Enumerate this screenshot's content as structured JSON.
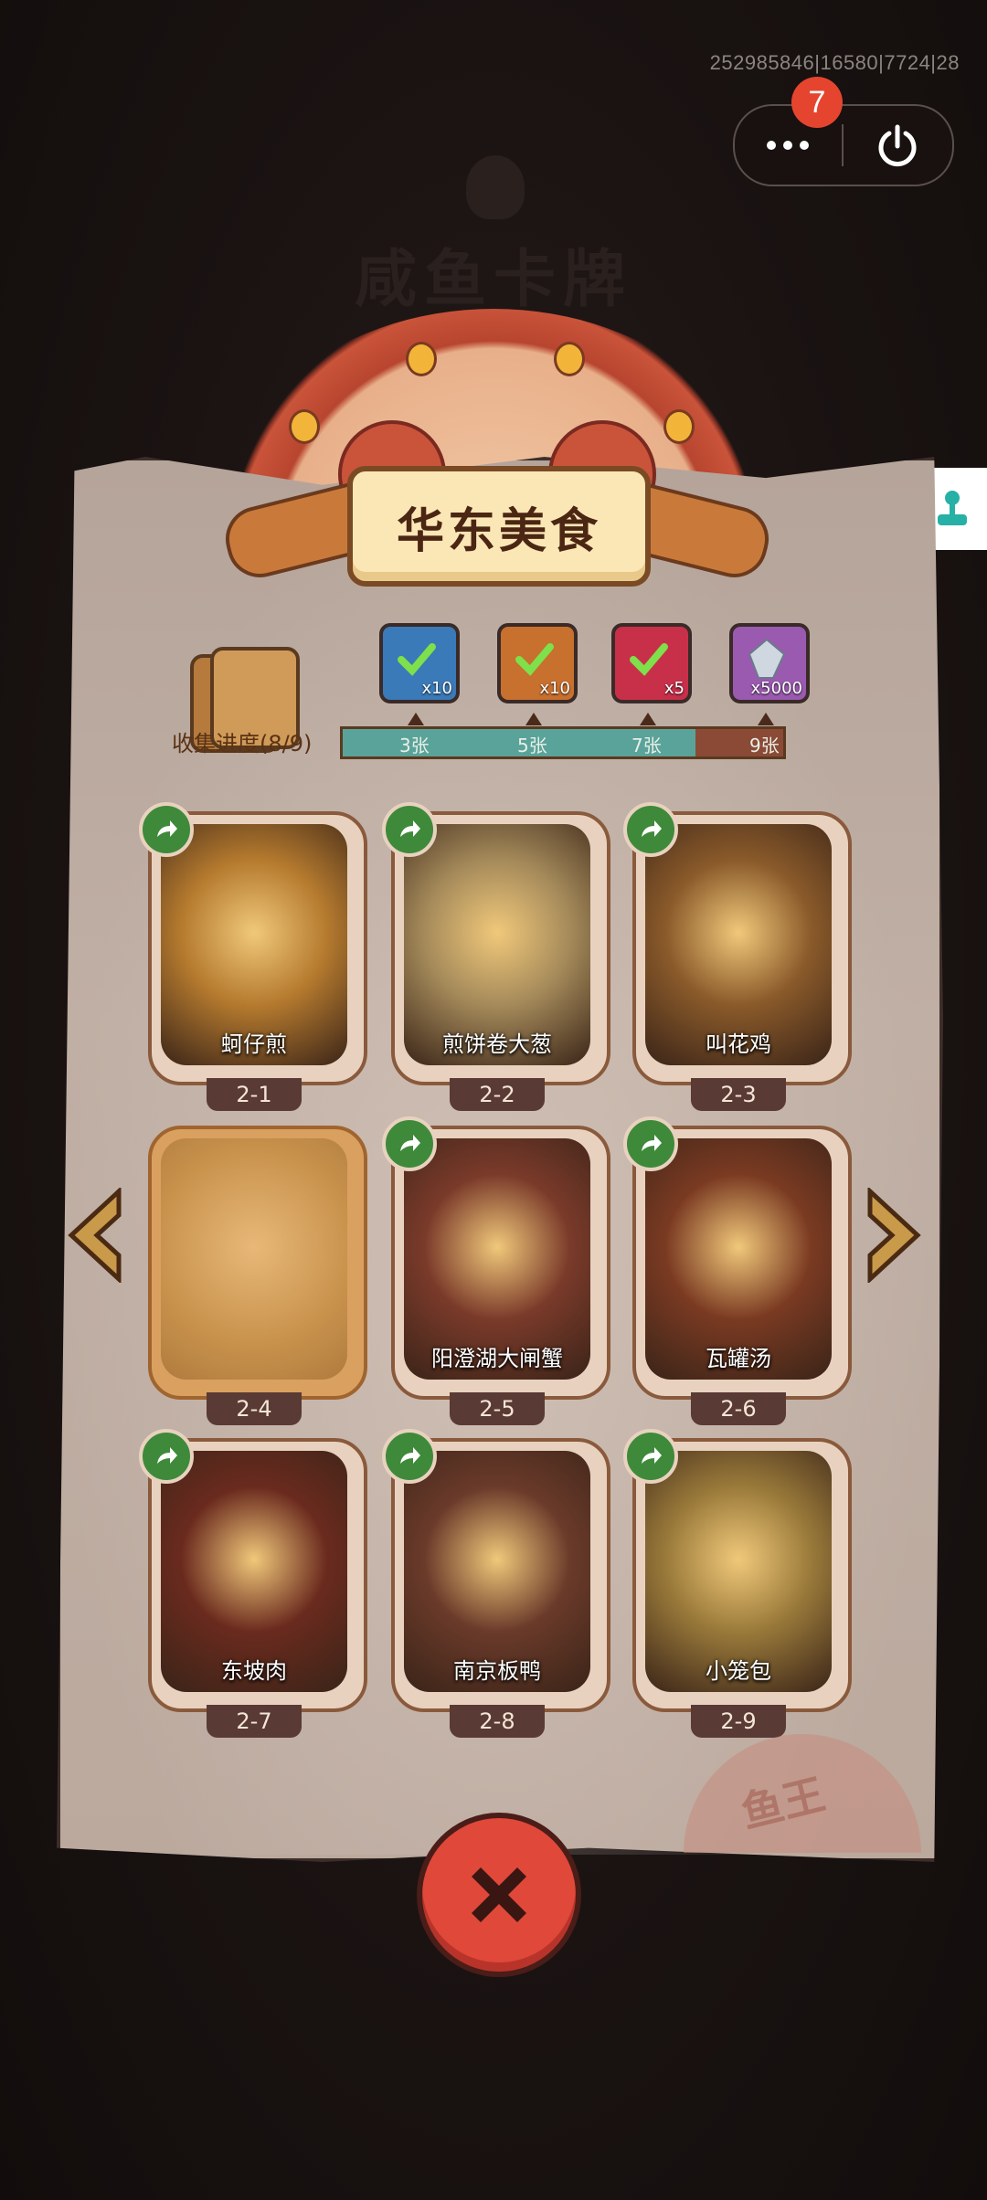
{
  "status": {
    "debug_text": "252985846|16580|7724|28",
    "notification_count": "7"
  },
  "background": {
    "title": "咸鱼卡牌"
  },
  "album": {
    "title": "华东美食",
    "collect_label": "收集进度(8/9)",
    "progress": 0.8,
    "milestones": [
      {
        "label": "3张",
        "reward_icon": "green-tick-jade-icon",
        "count": "x10",
        "color": "#3a7ab8"
      },
      {
        "label": "5张",
        "reward_icon": "green-tick-scroll-icon",
        "count": "x10",
        "color": "#c8702e"
      },
      {
        "label": "7张",
        "reward_icon": "green-tick-orb-icon",
        "count": "x5",
        "color": "#c8304a"
      },
      {
        "label": "9张",
        "reward_icon": "crystal-icon",
        "count": "x5000",
        "color": "#9a5ab0"
      }
    ]
  },
  "cards": [
    {
      "name": "蚵仔煎",
      "num": "2-1",
      "collected": true,
      "color": "#b57a2e"
    },
    {
      "name": "煎饼卷大葱",
      "num": "2-2",
      "collected": true,
      "color": "#a58a5a"
    },
    {
      "name": "叫花鸡",
      "num": "2-3",
      "collected": true,
      "color": "#8a5a2a"
    },
    {
      "name": "",
      "num": "2-4",
      "collected": false,
      "color": "#c8924c"
    },
    {
      "name": "阳澄湖大闸蟹",
      "num": "2-5",
      "collected": true,
      "color": "#7a3a2a"
    },
    {
      "name": "瓦罐汤",
      "num": "2-6",
      "collected": true,
      "color": "#7a3a22"
    },
    {
      "name": "东坡肉",
      "num": "2-7",
      "collected": true,
      "color": "#6a2a1e"
    },
    {
      "name": "南京板鸭",
      "num": "2-8",
      "collected": true,
      "color": "#6a3a2a"
    },
    {
      "name": "小笼包",
      "num": "2-9",
      "collected": true,
      "color": "#9a7a3a"
    }
  ],
  "stamp_text": "鱼王"
}
